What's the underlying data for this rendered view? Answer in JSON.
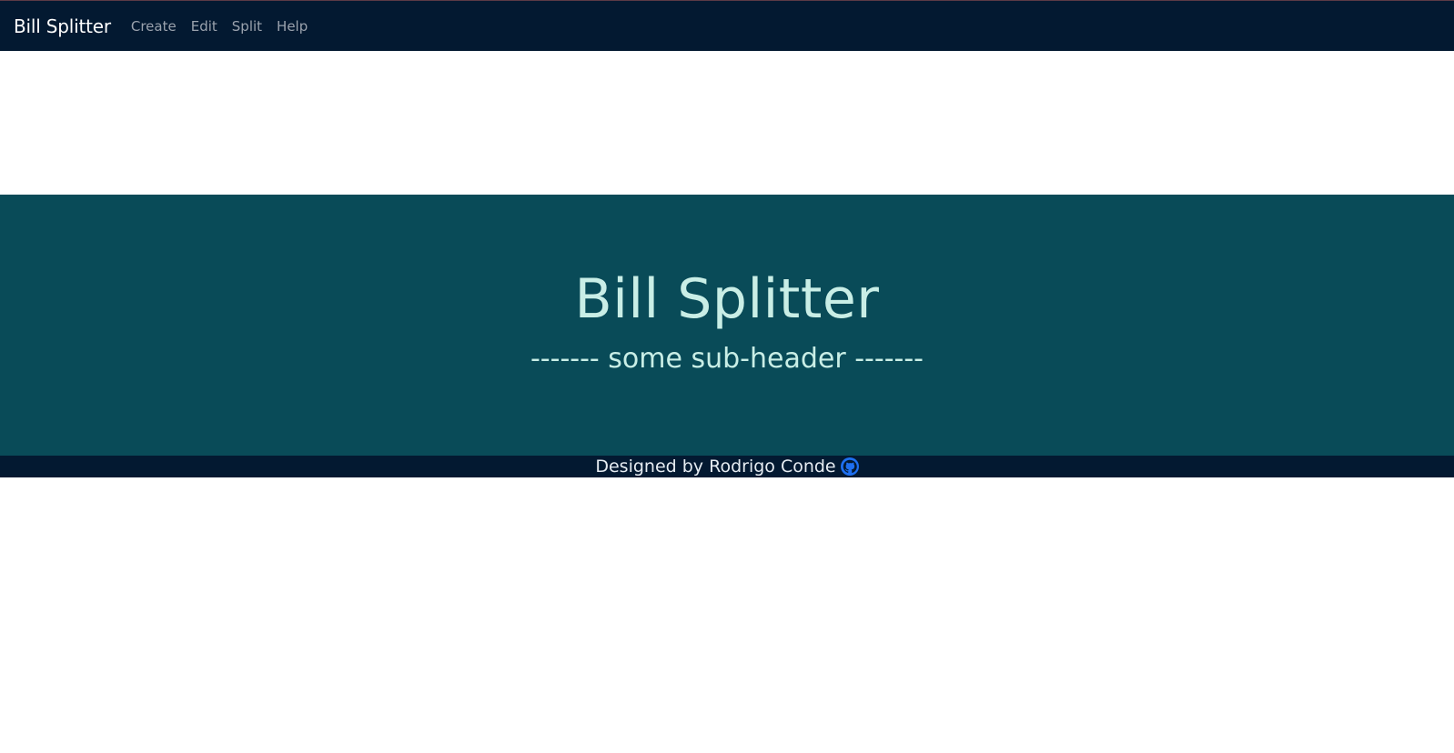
{
  "navbar": {
    "brand": "Bill Splitter",
    "links": [
      {
        "label": "Create"
      },
      {
        "label": "Edit"
      },
      {
        "label": "Split"
      },
      {
        "label": "Help"
      }
    ]
  },
  "hero": {
    "title": "Bill Splitter",
    "subtitle": "------- some sub-header -------"
  },
  "footer": {
    "text": "Designed by Rodrigo Conde",
    "icon": "github-icon"
  },
  "colors": {
    "navbar_bg": "#031931",
    "hero_bg": "#094b58",
    "hero_text": "#c9eee6",
    "github_icon": "#1e6ff0"
  }
}
